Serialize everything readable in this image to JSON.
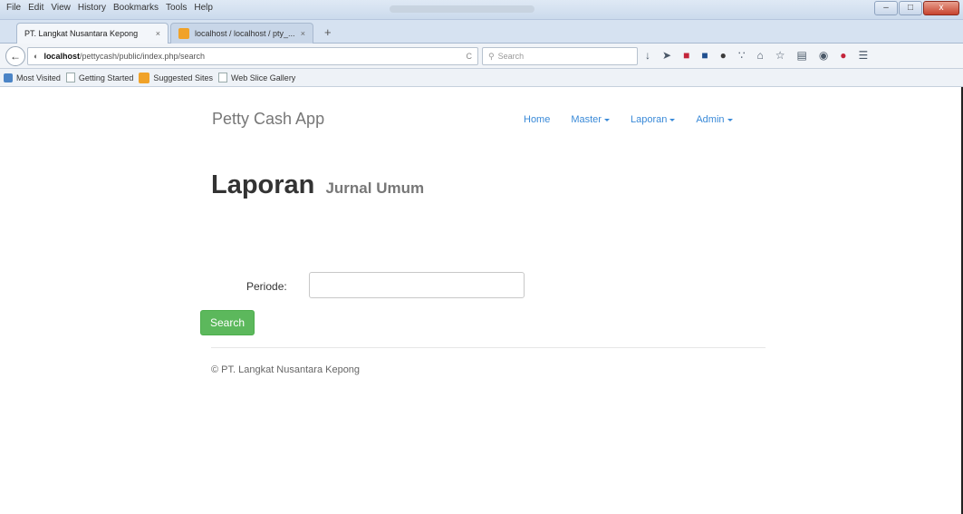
{
  "browser": {
    "menu": [
      "File",
      "Edit",
      "View",
      "History",
      "Bookmarks",
      "Tools",
      "Help"
    ],
    "window_controls": {
      "minimize": "–",
      "maximize": "□",
      "close": "x"
    },
    "tabs": [
      {
        "label": "PT. Langkat Nusantara Kepong",
        "close": "×",
        "active": true
      },
      {
        "label": "localhost / localhost / pty_...",
        "close": "×",
        "active": false
      }
    ],
    "new_tab": "+",
    "address": {
      "host": "localhost",
      "path": "/pettycash/public/index.php/search",
      "reload": "C"
    },
    "search": {
      "placeholder": "Search"
    },
    "bookmarks": [
      "Most Visited",
      "Getting Started",
      "Suggested Sites",
      "Web Slice Gallery"
    ]
  },
  "app": {
    "brand": "Petty Cash App",
    "nav": [
      {
        "label": "Home",
        "dropdown": false
      },
      {
        "label": "Master",
        "dropdown": true
      },
      {
        "label": "Laporan",
        "dropdown": true
      },
      {
        "label": "Admin",
        "dropdown": true
      }
    ],
    "title": "Laporan",
    "subtitle": "Jurnal Umum",
    "form": {
      "periode_label": "Periode:",
      "periode_value": ""
    },
    "search_button": "Search",
    "footer": "© PT. Langkat Nusantara Kepong"
  },
  "colors": {
    "link": "#3a8ad8",
    "primary_button": "#5cb85c"
  }
}
